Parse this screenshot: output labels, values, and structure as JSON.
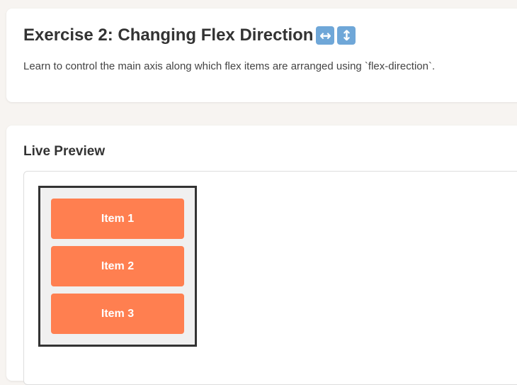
{
  "exercise": {
    "title": "Exercise 2: Changing Flex Direction",
    "emoji_horizontal": "↔",
    "emoji_vertical": "↕",
    "description": "Learn to control the main axis along which flex items are arranged using `flex-direction`."
  },
  "preview": {
    "heading": "Live Preview",
    "items": [
      "Item 1",
      "Item 2",
      "Item 3"
    ]
  },
  "colors": {
    "page_background": "#f7f4f1",
    "item_background": "#ff7f50",
    "container_border": "#333333",
    "container_background": "#f0f0f0"
  }
}
